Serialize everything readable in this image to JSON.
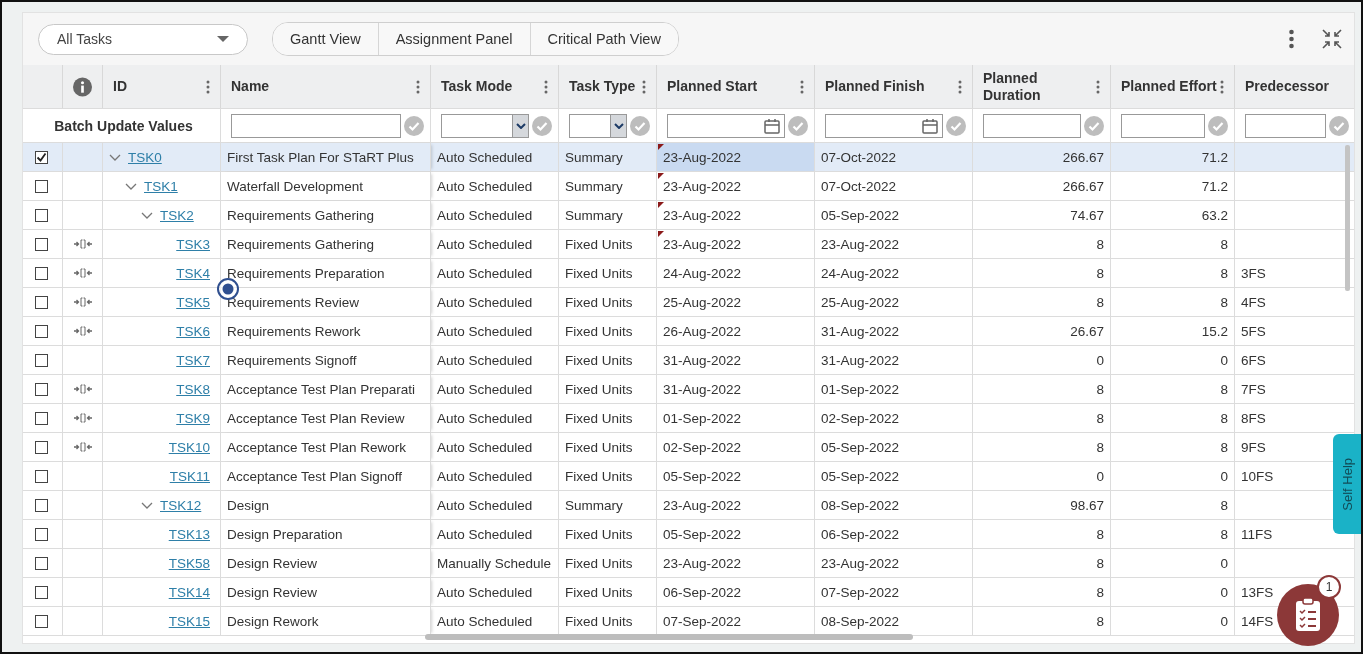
{
  "toolbar": {
    "filter_dropdown": {
      "value": "All Tasks"
    },
    "view_buttons": [
      {
        "label": "Gantt View",
        "selected": false
      },
      {
        "label": "Assignment Panel",
        "selected": false
      },
      {
        "label": "Critical Path View",
        "selected": false
      }
    ]
  },
  "grid": {
    "batch_label": "Batch Update Values",
    "columns": [
      {
        "label": "ID",
        "menu": true,
        "kind": "none"
      },
      {
        "label": "Name",
        "menu": true,
        "kind": "text"
      },
      {
        "label": "Task Mode",
        "menu": true,
        "kind": "select"
      },
      {
        "label": "Task Type",
        "menu": true,
        "kind": "select"
      },
      {
        "label": "Planned Start",
        "menu": true,
        "kind": "date"
      },
      {
        "label": "Planned Finish",
        "menu": true,
        "kind": "date"
      },
      {
        "label": "Planned Duration",
        "menu": true,
        "kind": "text"
      },
      {
        "label": "Planned Effort",
        "menu": true,
        "kind": "text"
      },
      {
        "label": "Predecessor",
        "menu": false,
        "kind": "text"
      }
    ],
    "rows": [
      {
        "id": "TSK0",
        "name": "First Task Plan For STaRT Plus",
        "mode": "Auto Scheduled",
        "type": "Summary",
        "start": "23-Aug-2022",
        "finish": "07-Oct-2022",
        "duration": "266.67",
        "effort": "71.2",
        "checked": true,
        "selected": true,
        "start_flag": true,
        "linked": false,
        "expanded": true,
        "children": [
          {
            "id": "TSK1",
            "name": "Waterfall Development",
            "mode": "Auto Scheduled",
            "type": "Summary",
            "start": "23-Aug-2022",
            "finish": "07-Oct-2022",
            "duration": "266.67",
            "effort": "71.2",
            "checked": false,
            "selected": false,
            "start_flag": true,
            "linked": false,
            "expanded": true,
            "children": [
              {
                "id": "TSK2",
                "name": "Requirements Gathering",
                "mode": "Auto Scheduled",
                "type": "Summary",
                "start": "23-Aug-2022",
                "finish": "05-Sep-2022",
                "duration": "74.67",
                "effort": "63.2",
                "checked": false,
                "selected": false,
                "start_flag": true,
                "linked": false,
                "expanded": true,
                "children": [
                  {
                    "id": "TSK3",
                    "name": "Requirements Gathering",
                    "mode": "Auto Scheduled",
                    "type": "Fixed Units",
                    "start": "23-Aug-2022",
                    "finish": "23-Aug-2022",
                    "duration": "8",
                    "effort": "8",
                    "checked": false,
                    "selected": false,
                    "start_flag": true,
                    "linked": true
                  },
                  {
                    "id": "TSK4",
                    "name": "Requirements Preparation",
                    "mode": "Auto Scheduled",
                    "type": "Fixed Units",
                    "start": "24-Aug-2022",
                    "finish": "24-Aug-2022",
                    "duration": "8",
                    "effort": "8",
                    "predecessor": "3FS",
                    "checked": false,
                    "selected": false,
                    "start_flag": false,
                    "linked": true,
                    "pointer": true
                  },
                  {
                    "id": "TSK5",
                    "name": "Requirements Review",
                    "mode": "Auto Scheduled",
                    "type": "Fixed Units",
                    "start": "25-Aug-2022",
                    "finish": "25-Aug-2022",
                    "duration": "8",
                    "effort": "8",
                    "predecessor": "4FS",
                    "checked": false,
                    "selected": false,
                    "start_flag": false,
                    "linked": true
                  },
                  {
                    "id": "TSK6",
                    "name": "Requirements Rework",
                    "mode": "Auto Scheduled",
                    "type": "Fixed Units",
                    "start": "26-Aug-2022",
                    "finish": "31-Aug-2022",
                    "duration": "26.67",
                    "effort": "15.2",
                    "predecessor": "5FS",
                    "checked": false,
                    "selected": false,
                    "start_flag": false,
                    "linked": true
                  },
                  {
                    "id": "TSK7",
                    "name": "Requirements Signoff",
                    "mode": "Auto Scheduled",
                    "type": "Fixed Units",
                    "start": "31-Aug-2022",
                    "finish": "31-Aug-2022",
                    "duration": "0",
                    "effort": "0",
                    "predecessor": "6FS",
                    "checked": false,
                    "selected": false,
                    "start_flag": false,
                    "linked": false
                  },
                  {
                    "id": "TSK8",
                    "name": "Acceptance Test Plan Preparati",
                    "mode": "Auto Scheduled",
                    "type": "Fixed Units",
                    "start": "31-Aug-2022",
                    "finish": "01-Sep-2022",
                    "duration": "8",
                    "effort": "8",
                    "predecessor": "7FS",
                    "checked": false,
                    "selected": false,
                    "start_flag": false,
                    "linked": true
                  },
                  {
                    "id": "TSK9",
                    "name": "Acceptance Test Plan Review",
                    "mode": "Auto Scheduled",
                    "type": "Fixed Units",
                    "start": "01-Sep-2022",
                    "finish": "02-Sep-2022",
                    "duration": "8",
                    "effort": "8",
                    "predecessor": "8FS",
                    "checked": false,
                    "selected": false,
                    "start_flag": false,
                    "linked": true
                  },
                  {
                    "id": "TSK10",
                    "name": "Acceptance Test Plan Rework",
                    "mode": "Auto Scheduled",
                    "type": "Fixed Units",
                    "start": "02-Sep-2022",
                    "finish": "05-Sep-2022",
                    "duration": "8",
                    "effort": "8",
                    "predecessor": "9FS",
                    "checked": false,
                    "selected": false,
                    "start_flag": false,
                    "linked": true
                  },
                  {
                    "id": "TSK11",
                    "name": "Acceptance Test Plan Signoff",
                    "mode": "Auto Scheduled",
                    "type": "Fixed Units",
                    "start": "05-Sep-2022",
                    "finish": "05-Sep-2022",
                    "duration": "0",
                    "effort": "0",
                    "predecessor": "10FS",
                    "checked": false,
                    "selected": false,
                    "start_flag": false,
                    "linked": false
                  }
                ]
              },
              {
                "id": "TSK12",
                "name": "Design",
                "mode": "Auto Scheduled",
                "type": "Summary",
                "start": "23-Aug-2022",
                "finish": "08-Sep-2022",
                "duration": "98.67",
                "effort": "8",
                "checked": false,
                "selected": false,
                "start_flag": false,
                "linked": false,
                "expanded": true,
                "children": [
                  {
                    "id": "TSK13",
                    "name": "Design Preparation",
                    "mode": "Auto Scheduled",
                    "type": "Fixed Units",
                    "start": "05-Sep-2022",
                    "finish": "06-Sep-2022",
                    "duration": "8",
                    "effort": "8",
                    "predecessor": "11FS",
                    "checked": false,
                    "selected": false,
                    "start_flag": false,
                    "linked": false
                  },
                  {
                    "id": "TSK58",
                    "name": "Design Review",
                    "mode": "Manually Schedule",
                    "type": "Fixed Units",
                    "start": "23-Aug-2022",
                    "finish": "23-Aug-2022",
                    "duration": "8",
                    "effort": "0",
                    "checked": false,
                    "selected": false,
                    "start_flag": false,
                    "linked": false
                  },
                  {
                    "id": "TSK14",
                    "name": "Design Review",
                    "mode": "Auto Scheduled",
                    "type": "Fixed Units",
                    "start": "06-Sep-2022",
                    "finish": "07-Sep-2022",
                    "duration": "8",
                    "effort": "0",
                    "predecessor": "13FS",
                    "checked": false,
                    "selected": false,
                    "start_flag": false,
                    "linked": false
                  },
                  {
                    "id": "TSK15",
                    "name": "Design Rework",
                    "mode": "Auto Scheduled",
                    "type": "Fixed Units",
                    "start": "07-Sep-2022",
                    "finish": "08-Sep-2022",
                    "duration": "8",
                    "effort": "0",
                    "predecessor": "14FS",
                    "checked": false,
                    "selected": false,
                    "start_flag": false,
                    "linked": false
                  }
                ]
              }
            ]
          }
        ]
      }
    ]
  },
  "self_help": {
    "label": "Self Help"
  },
  "fab": {
    "badge": "1"
  }
}
